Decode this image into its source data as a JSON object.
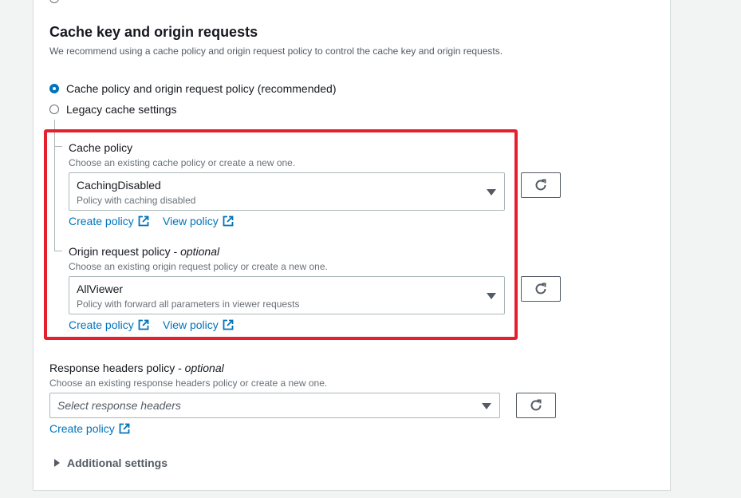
{
  "section": {
    "title": "Cache key and origin requests",
    "description": "We recommend using a cache policy and origin request policy to control the cache key and origin requests."
  },
  "options": [
    {
      "label": "Cache policy and origin request policy (recommended)",
      "selected": true
    },
    {
      "label": "Legacy cache settings",
      "selected": false
    }
  ],
  "cache_policy": {
    "label": "Cache policy",
    "hint": "Choose an existing cache policy or create a new one.",
    "value": "CachingDisabled",
    "value_description": "Policy with caching disabled",
    "create_link": "Create policy",
    "view_link": "View policy"
  },
  "origin_request_policy": {
    "label": "Origin request policy",
    "label_suffix": "optional",
    "separator": " - ",
    "hint": "Choose an existing origin request policy or create a new one.",
    "value": "AllViewer",
    "value_description": "Policy with forward all parameters in viewer requests",
    "create_link": "Create policy",
    "view_link": "View policy"
  },
  "response_headers_policy": {
    "label": "Response headers policy",
    "label_suffix": "optional",
    "separator": " - ",
    "hint": "Choose an existing response headers policy or create a new one.",
    "placeholder": "Select response headers",
    "create_link": "Create policy"
  },
  "additional_settings": {
    "label": "Additional settings"
  },
  "colors": {
    "accent": "#0073bb",
    "highlight": "#e4202f",
    "text": "#16191f",
    "muted": "#687078"
  },
  "icons": {
    "refresh": "refresh-icon",
    "external": "external-link-icon",
    "caret": "caret-down-icon",
    "expand": "caret-right-icon"
  }
}
